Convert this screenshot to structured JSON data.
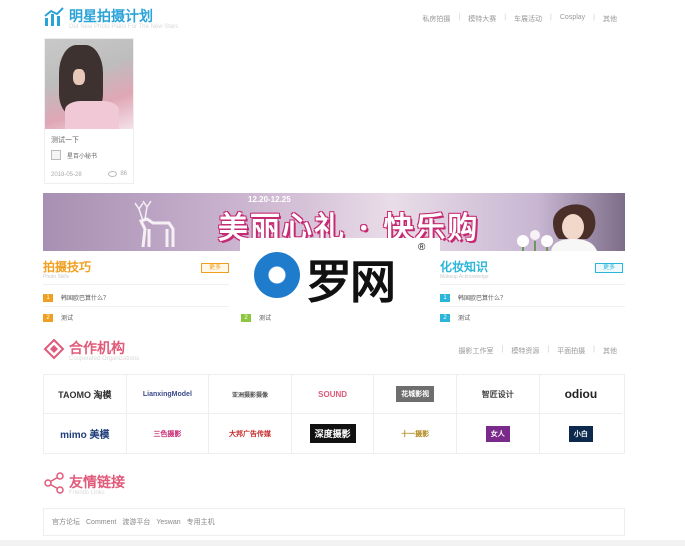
{
  "stars_section": {
    "title": "明星拍摄计划",
    "subtitle": "Out New Photo Plans For The New Stars",
    "nav": [
      "私房拍摄",
      "模特大赛",
      "车展活动",
      "Cosplay",
      "其他"
    ]
  },
  "card": {
    "title": "测试一下",
    "author": "星百小秘书",
    "date": "2018-05-28",
    "views": "86"
  },
  "banner": {
    "date": "12.20-12.25",
    "slogan": "美丽心礼 · 快乐购"
  },
  "photo_skills": {
    "title": "拍摄技巧",
    "subtitle": "Photo Skills",
    "more": "更多",
    "items": [
      {
        "badge": "1",
        "text": "韩国欧巴算什么？",
        "color": "#f0a020"
      },
      {
        "badge": "2",
        "text": "测试",
        "color": "#f0a020"
      }
    ]
  },
  "middle_col": {
    "items": [
      {
        "badge": "1",
        "text": "",
        "color": "#8cc63f"
      },
      {
        "badge": "2",
        "text": "测试",
        "color": "#8cc63f"
      }
    ]
  },
  "makeup": {
    "title": "化妆知识",
    "subtitle": "Makeup Acknowledge",
    "more": "更多",
    "items": [
      {
        "badge": "1",
        "text": "韩国欧巴算什么？",
        "color": "#29b6d9"
      },
      {
        "badge": "2",
        "text": "测试",
        "color": "#29b6d9"
      }
    ]
  },
  "watermark": {
    "text": "罗网",
    "reg": "®"
  },
  "partners_section": {
    "title": "合作机构",
    "subtitle": "Cooperated Organizations",
    "nav": [
      "摄影工作室",
      "模特资源",
      "平面拍摄",
      "其他"
    ],
    "logos": [
      "TAOMO 淘模",
      "LianxingModel",
      "亚洲摄影摄像",
      "SOUND",
      "花城影视",
      "智匠设计",
      "odiou",
      "mimo 美模",
      "三色摄影",
      "大邦广告传媒",
      "深度摄影",
      "十一摄影",
      "女人",
      "小白"
    ]
  },
  "links_section": {
    "title": "友情链接",
    "subtitle": "Friends Links",
    "items": [
      "官方论坛",
      "Comment",
      "渡游平台",
      "Yeswan",
      "专用主机"
    ]
  },
  "colors": {
    "pink": "#e05a7a",
    "orange": "#f0a020",
    "green": "#8cc63f",
    "cyan": "#29b6d9"
  }
}
